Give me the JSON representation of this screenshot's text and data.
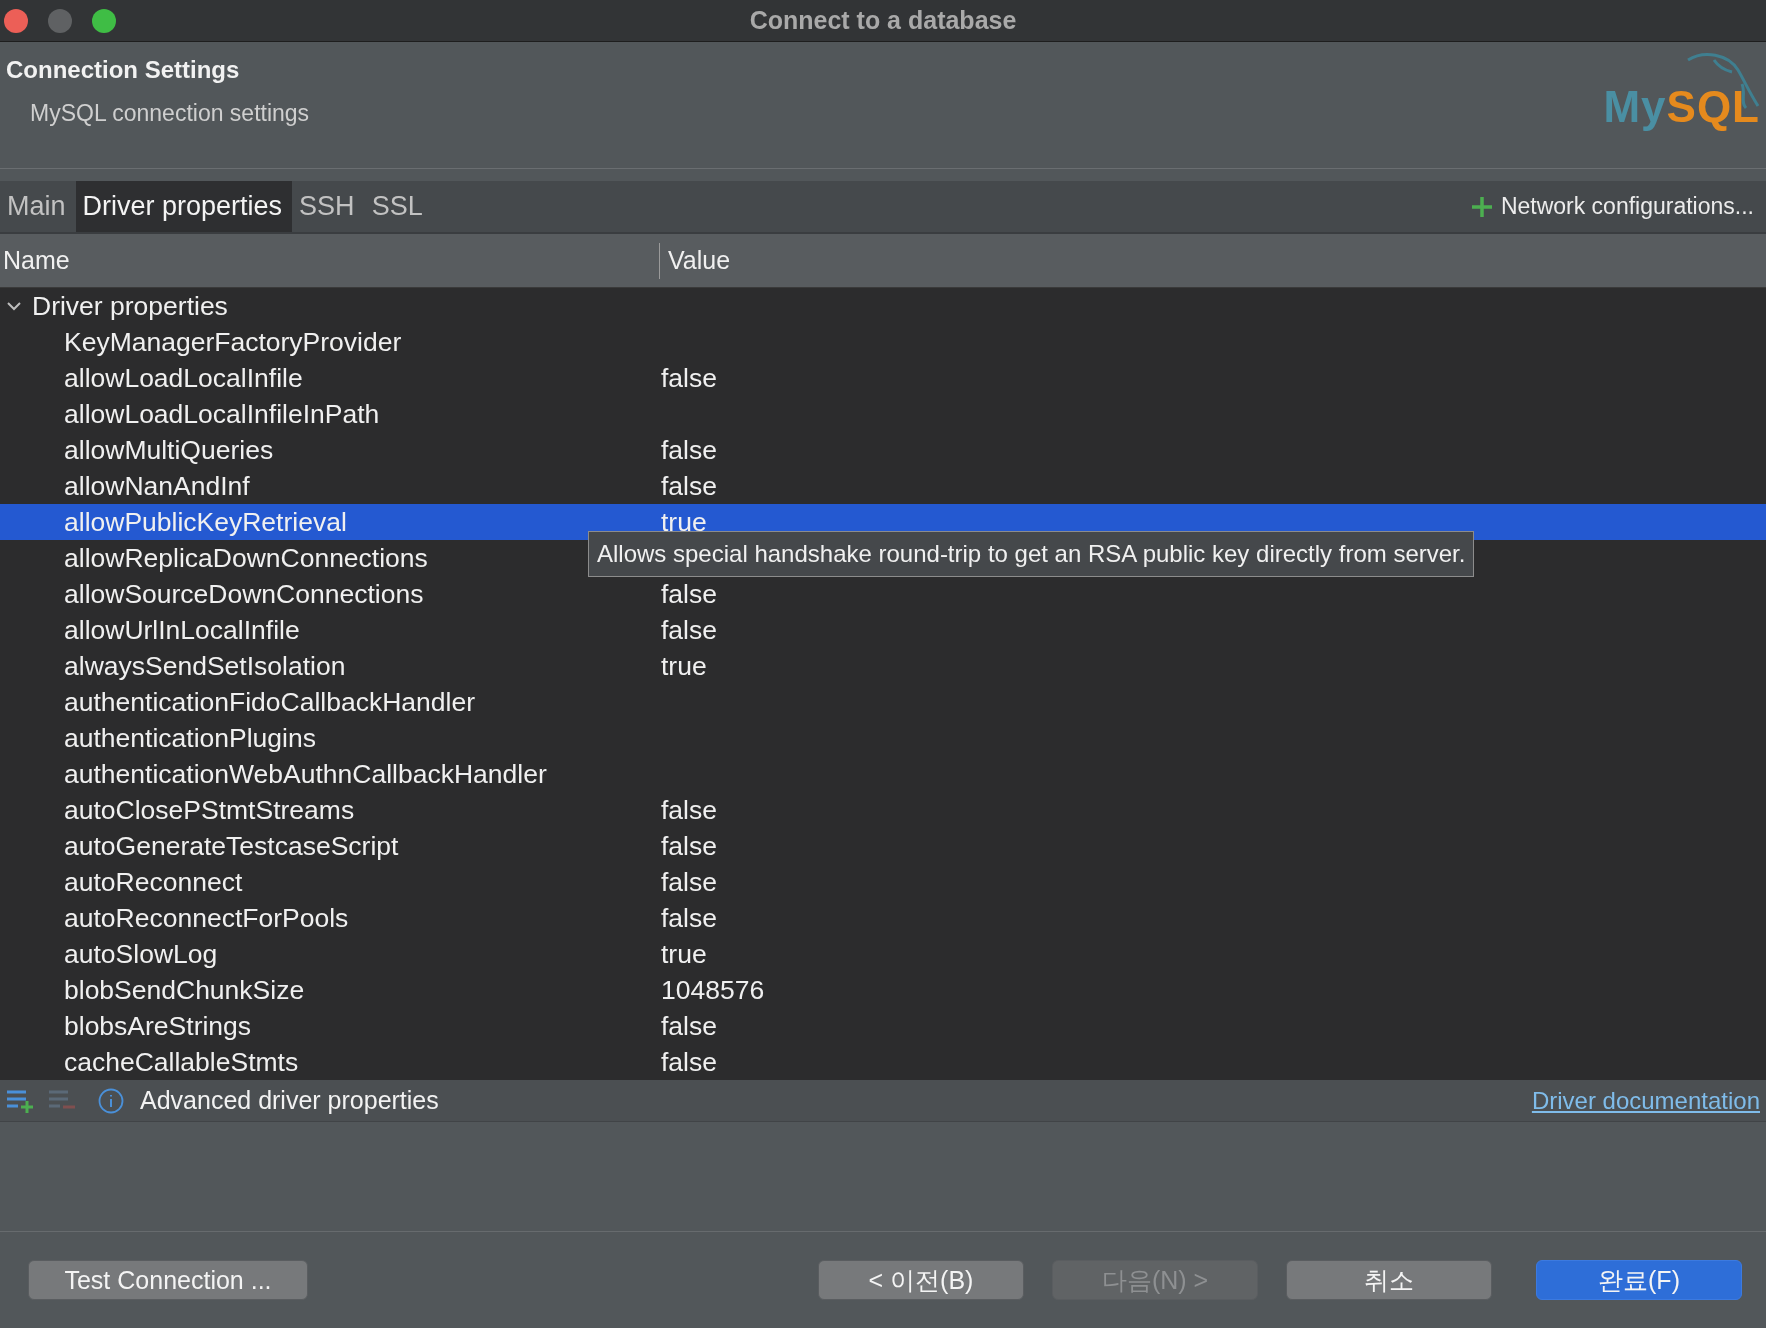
{
  "window": {
    "title": "Connect to a database"
  },
  "header": {
    "title": "Connection Settings",
    "subtitle": "MySQL connection settings",
    "logo": [
      "My",
      "SQL"
    ]
  },
  "tabs": [
    {
      "label": "Main",
      "selected": false
    },
    {
      "label": "Driver properties",
      "selected": true
    },
    {
      "label": "SSH",
      "selected": false
    },
    {
      "label": "SSL",
      "selected": false
    }
  ],
  "network_button": {
    "label": "Network configurations..."
  },
  "table": {
    "columns": [
      "Name",
      "Value"
    ],
    "tree": {
      "label": "Driver properties",
      "expanded": true,
      "children": [
        {
          "name": "KeyManagerFactoryProvider",
          "selected": false
        },
        {
          "name": "allowLoadLocalInfile",
          "value": "false",
          "selected": false
        },
        {
          "name": "allowLoadLocalInfileInPath",
          "selected": false
        },
        {
          "name": "allowMultiQueries",
          "value": "false",
          "selected": false
        },
        {
          "name": "allowNanAndInf",
          "value": "false",
          "selected": false
        },
        {
          "name": "allowPublicKeyRetrieval",
          "value": "true",
          "selected": true
        },
        {
          "name": "allowReplicaDownConnections",
          "selected": false
        },
        {
          "name": "allowSourceDownConnections",
          "value": "false",
          "selected": false
        },
        {
          "name": "allowUrlInLocalInfile",
          "value": "false",
          "selected": false
        },
        {
          "name": "alwaysSendSetIsolation",
          "value": "true",
          "selected": false
        },
        {
          "name": "authenticationFidoCallbackHandler",
          "selected": false
        },
        {
          "name": "authenticationPlugins",
          "selected": false
        },
        {
          "name": "authenticationWebAuthnCallbackHandler",
          "selected": false
        },
        {
          "name": "autoClosePStmtStreams",
          "value": "false",
          "selected": false
        },
        {
          "name": "autoGenerateTestcaseScript",
          "value": "false",
          "selected": false
        },
        {
          "name": "autoReconnect",
          "value": "false",
          "selected": false
        },
        {
          "name": "autoReconnectForPools",
          "value": "false",
          "selected": false
        },
        {
          "name": "autoSlowLog",
          "value": "true",
          "selected": false
        },
        {
          "name": "blobSendChunkSize",
          "value": "1048576",
          "selected": false
        },
        {
          "name": "blobsAreStrings",
          "value": "false",
          "selected": false
        },
        {
          "name": "cacheCallableStmts",
          "value": "false",
          "selected": false
        }
      ]
    }
  },
  "tooltip": "Allows special handshake round-trip to get an RSA public key directly from server.",
  "toolbar": {
    "label": "Advanced driver properties",
    "link": "Driver documentation",
    "remove_disabled": true
  },
  "buttons": [
    {
      "label": "Test Connection ...",
      "disabled": false,
      "default": false
    },
    {
      "label": "< 이전(B)",
      "disabled": false,
      "default": false
    },
    {
      "label": "다음(N) >",
      "disabled": true,
      "default": false
    },
    {
      "label": "취소",
      "disabled": false,
      "default": false
    },
    {
      "label": "완료(F)",
      "disabled": false,
      "default": true
    }
  ]
}
